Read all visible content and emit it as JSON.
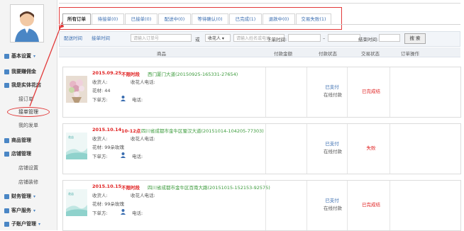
{
  "sidebar": {
    "groups": [
      {
        "label": "基本设置",
        "subs": []
      },
      {
        "label": "我要赚佣金",
        "subs": []
      },
      {
        "label": "我是实体花店",
        "subs": [
          "接订单",
          "接单管理"
        ]
      },
      {
        "label": "",
        "subs": [
          "我的发单"
        ]
      },
      {
        "label": "商品管理",
        "subs": []
      },
      {
        "label": "店铺管理",
        "subs": [
          "店铺设置",
          "店铺装修"
        ]
      },
      {
        "label": "财务管理",
        "subs": []
      },
      {
        "label": "客户服务",
        "subs": []
      },
      {
        "label": "子账户管理",
        "subs": []
      }
    ]
  },
  "tabs": [
    {
      "label": "所有订单",
      "active": true
    },
    {
      "label": "待接单(0)"
    },
    {
      "label": "已接单(0)"
    },
    {
      "label": "配送中(0)"
    },
    {
      "label": "等待确认(0)"
    },
    {
      "label": "已完成(1)"
    },
    {
      "label": "退款中(0)"
    },
    {
      "label": "交易失败(1)"
    }
  ],
  "filter": {
    "btn_time": "配送时间",
    "btn_order_time": "接单时间",
    "order_placeholder": "请输入订单号",
    "or": "或",
    "select_label": "收花人",
    "name_placeholder": "请输入姓名或电话",
    "date_start_label": "下单时间:",
    "dash": "–",
    "time_label": "结束时间:",
    "search_label": "搜 索"
  },
  "table_header": {
    "product": "商品",
    "amount": "付款金额",
    "pay_status": "付款状态",
    "trade_status": "交易状态",
    "actions": "订单操作"
  },
  "orders": [
    {
      "date": "2015.09.25",
      "limit": "不限时段",
      "address": "西门厦门大道(20150925-165331-27654)",
      "receiver_label": "收货人:",
      "receiver_phone_label": "收花人电话:",
      "flower_label": "花材: 44",
      "orderer_label": "下单方:",
      "phone_label": "电话:",
      "pay": "已支付",
      "pay_sub": "在线付款",
      "status": "已完成结"
    },
    {
      "date": "2015.10.14",
      "limit": "10-12点",
      "address": "四川省成都市金牛区蜀汉大道(20151014-104205-77303)",
      "receiver_label": "收货人:",
      "receiver_phone_label": "收花人电话:",
      "flower_label": "花材: 99朵玫瑰",
      "orderer_label": "下单方:",
      "phone_label": "电话:",
      "pay": "已支付",
      "pay_sub": "在线付款",
      "status": "失败"
    },
    {
      "date": "2015.10.15",
      "limit": "不限时段",
      "address": "四川省成都市金牛区百南大路(20151015-152153-92575)",
      "receiver_label": "收货人:",
      "receiver_phone_label": "收花人电话:",
      "flower_label": "花材: 99朵玫瑰",
      "orderer_label": "下单方:",
      "phone_label": "电话:",
      "pay": "已支付",
      "pay_sub": "在线付款",
      "status": "已完成结"
    }
  ]
}
